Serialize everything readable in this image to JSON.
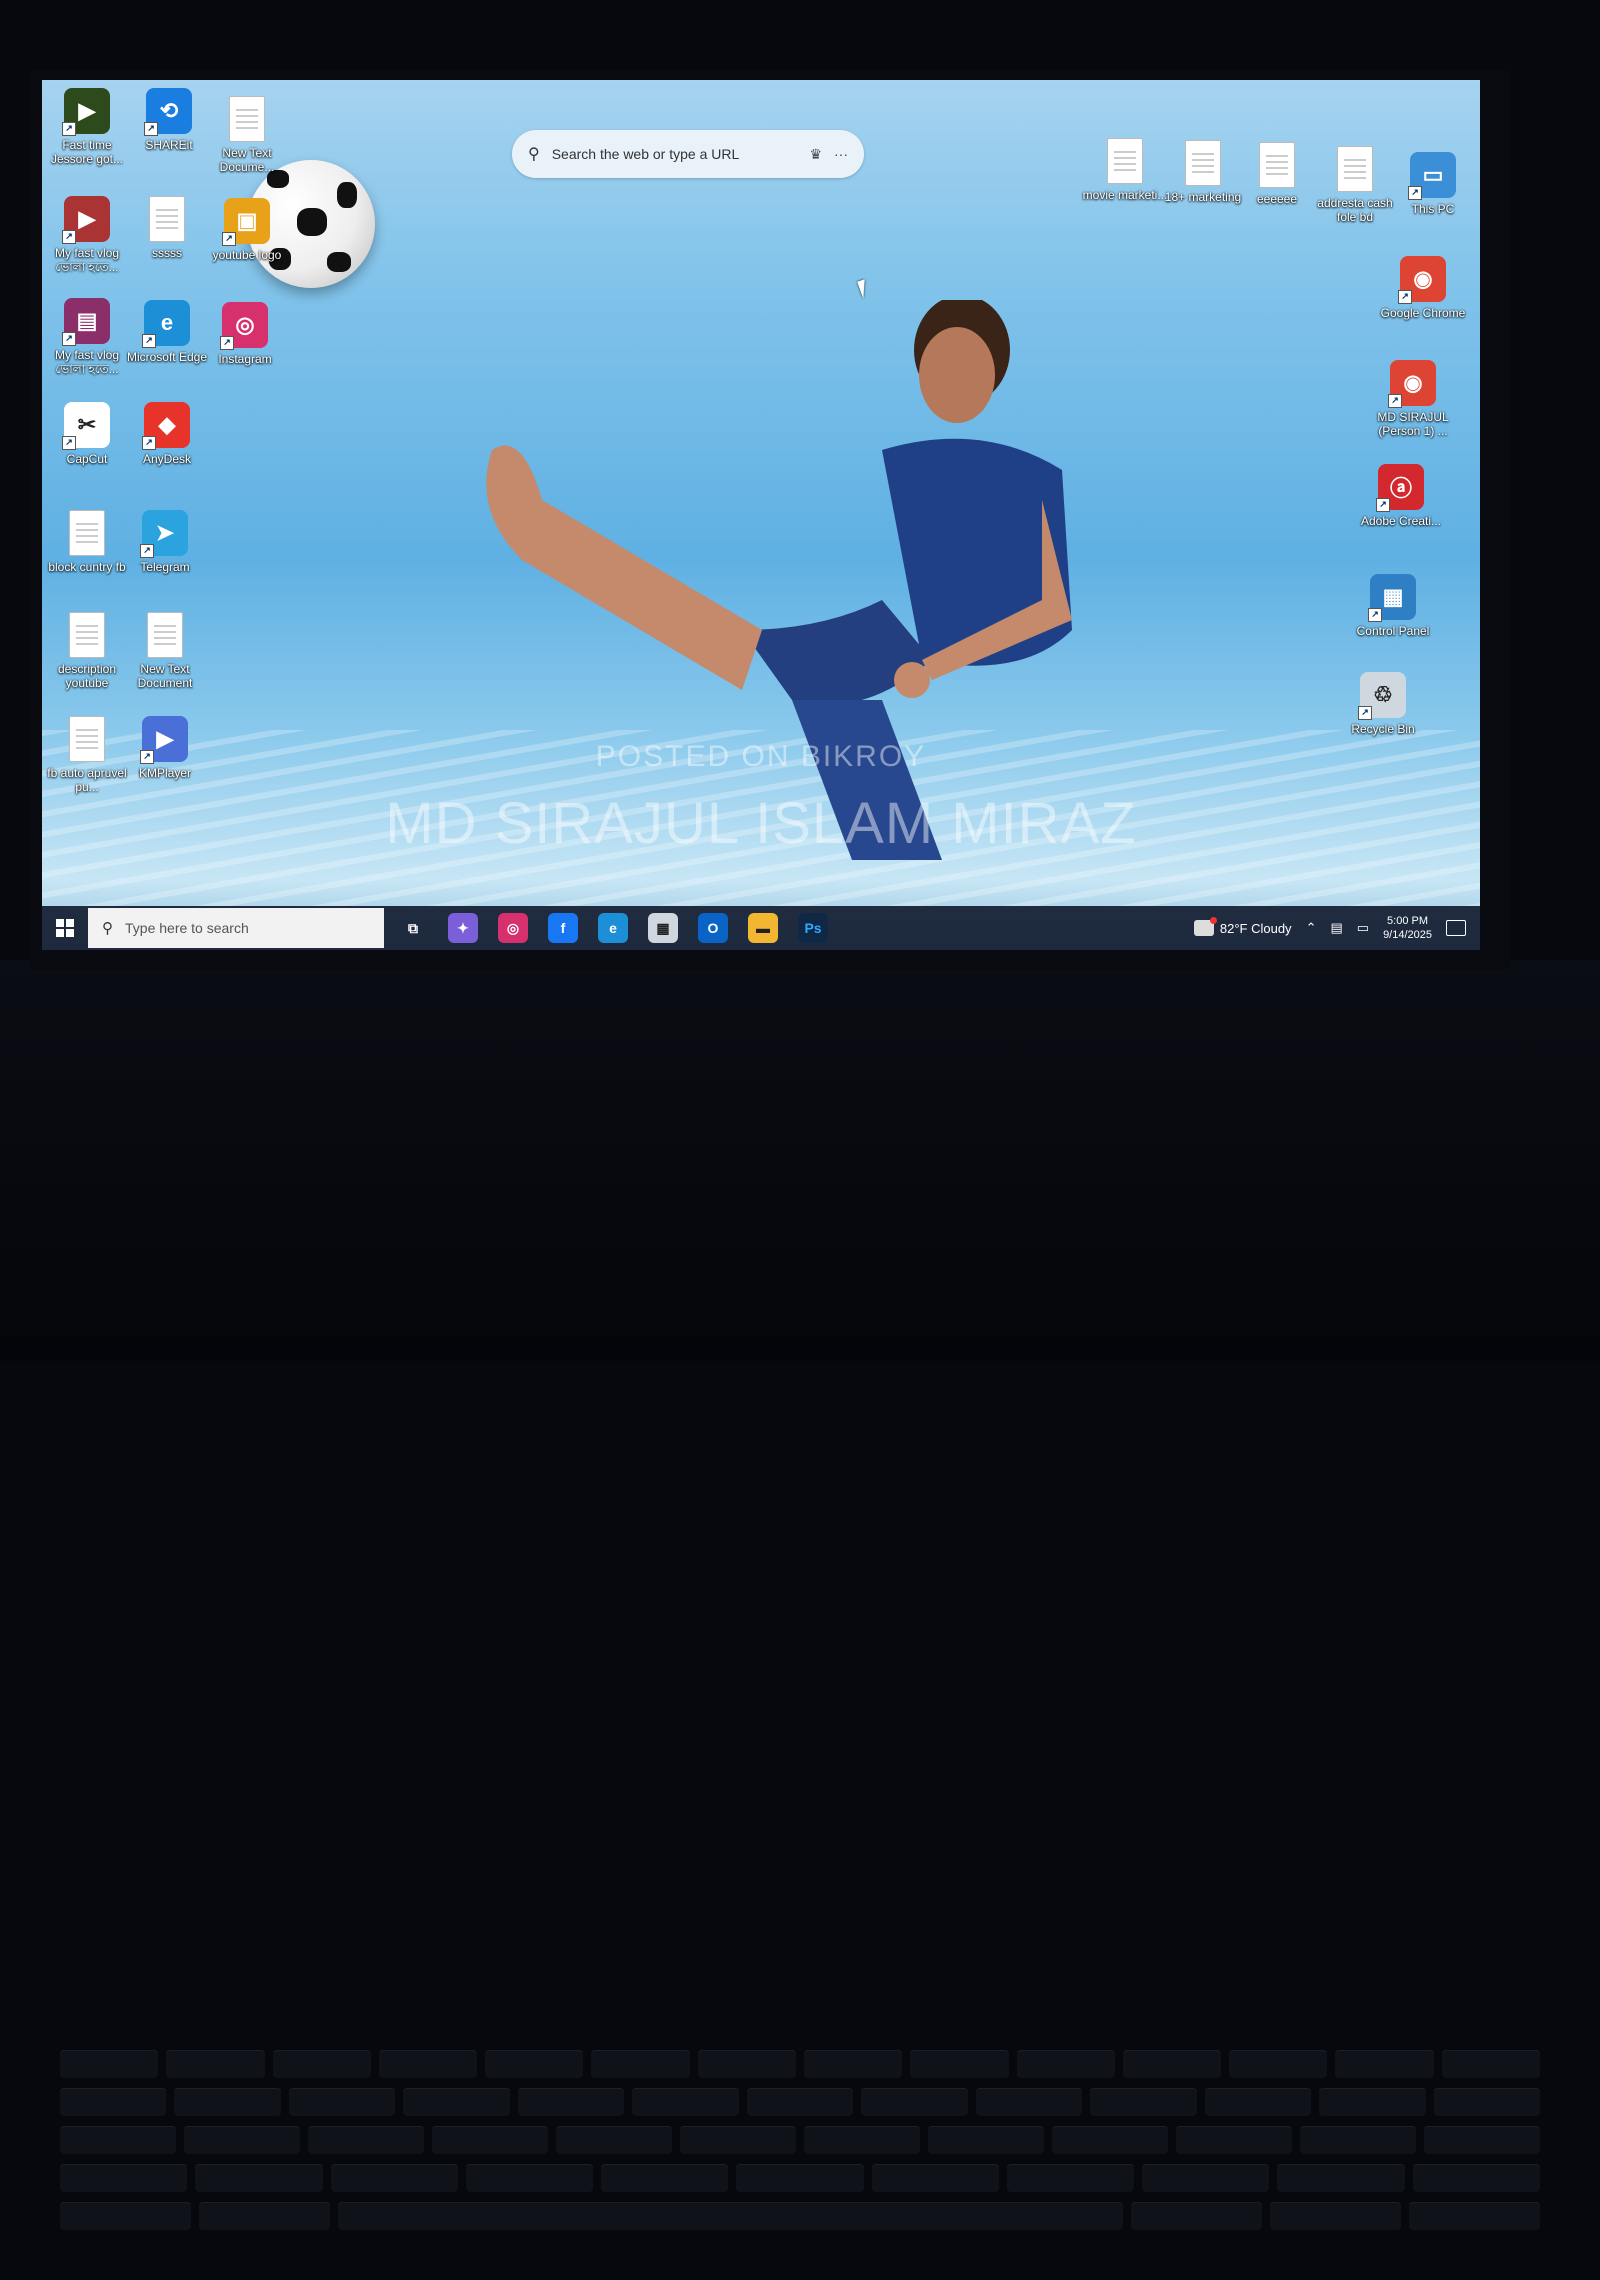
{
  "browser_search": {
    "placeholder": "Search the web or type a URL",
    "more_label": "···"
  },
  "desktop_left": [
    {
      "label": "Fast time Jessore got...",
      "icon": "video-icon",
      "color": "#2d4a1c"
    },
    {
      "label": "SHAREit",
      "icon": "shareit-icon",
      "color": "#1a7de0"
    },
    {
      "label": "New Text Docume...",
      "icon": "text-document-icon",
      "color": "#ffffff"
    },
    {
      "label": "My fast vlog ভোলা হতে...",
      "icon": "video-thumbnail-icon",
      "color": "#a33"
    },
    {
      "label": "sssss",
      "icon": "text-document-icon",
      "color": "#ffffff"
    },
    {
      "label": "youtube logo",
      "icon": "image-file-icon",
      "color": "#e8a21a"
    },
    {
      "label": "My fast vlog ভোলা হতে...",
      "icon": "winrar-archive-icon",
      "color": "#8b2f6b"
    },
    {
      "label": "Microsoft Edge",
      "icon": "edge-icon",
      "color": "#1d8fd6"
    },
    {
      "label": "Instagram",
      "icon": "instagram-icon",
      "color": "#d6306d"
    },
    {
      "label": "CapCut",
      "icon": "capcut-icon",
      "color": "#ffffff"
    },
    {
      "label": "AnyDesk",
      "icon": "anydesk-icon",
      "color": "#e8332b"
    },
    {
      "label": "block cuntry fb",
      "icon": "text-document-icon",
      "color": "#ffffff"
    },
    {
      "label": "Telegram",
      "icon": "telegram-icon",
      "color": "#2aa3df"
    },
    {
      "label": "description youtube",
      "icon": "text-document-icon",
      "color": "#ffffff"
    },
    {
      "label": "New Text Document",
      "icon": "text-document-icon",
      "color": "#ffffff"
    },
    {
      "label": "fb auto apruvel pu...",
      "icon": "text-document-icon",
      "color": "#ffffff"
    },
    {
      "label": "KMPlayer",
      "icon": "kmplayer-icon",
      "color": "#4a6fd6"
    }
  ],
  "desktop_right": [
    {
      "label": "movie marketi...",
      "icon": "text-document-icon",
      "color": "#ffffff"
    },
    {
      "label": "18+ marketing",
      "icon": "text-document-icon",
      "color": "#ffffff"
    },
    {
      "label": "eeeeee",
      "icon": "text-document-icon",
      "color": "#ffffff"
    },
    {
      "label": "addresta cash fole bd",
      "icon": "text-document-icon",
      "color": "#ffffff"
    },
    {
      "label": "This PC",
      "icon": "monitor-icon",
      "color": "#3b8fd6"
    },
    {
      "label": "Google Chrome",
      "icon": "chrome-icon",
      "color": "#dd4433"
    },
    {
      "label": "MD SIRAJUL (Person 1) ...",
      "icon": "chrome-profile-icon",
      "color": "#dd4433"
    },
    {
      "label": "Adobe Creati...",
      "icon": "adobe-cc-icon",
      "color": "#d4282f"
    },
    {
      "label": "Control Panel",
      "icon": "control-panel-icon",
      "color": "#2f7fc4"
    },
    {
      "label": "Recycle Bin",
      "icon": "recycle-bin-icon",
      "color": "#cfd8df"
    }
  ],
  "taskbar": {
    "search_placeholder": "Type here to search",
    "apps": [
      {
        "name": "task-view-icon",
        "glyph": "⧉",
        "color": "transparent"
      },
      {
        "name": "copilot-icon",
        "glyph": "✦",
        "color": "#7b5fd9"
      },
      {
        "name": "instagram-icon",
        "glyph": "◎",
        "color": "#d6306d"
      },
      {
        "name": "facebook-icon",
        "glyph": "f",
        "color": "#1877f2"
      },
      {
        "name": "edge-icon",
        "glyph": "e",
        "color": "#1d8fd6"
      },
      {
        "name": "microsoft-store-icon",
        "glyph": "▦",
        "color": "#cfd6de"
      },
      {
        "name": "outlook-icon",
        "glyph": "O",
        "color": "#0a64c8"
      },
      {
        "name": "file-explorer-icon",
        "glyph": "▬",
        "color": "#f2b632"
      },
      {
        "name": "photoshop-icon",
        "glyph": "Ps",
        "color": "#0f2846"
      }
    ],
    "weather": "82°F  Cloudy",
    "time": "5:00 PM",
    "date": "9/14/2025"
  },
  "watermark": {
    "line1": "POSTED ON BIKROY",
    "line2": "MD SIRAJUL ISLAM MIRAZ"
  }
}
